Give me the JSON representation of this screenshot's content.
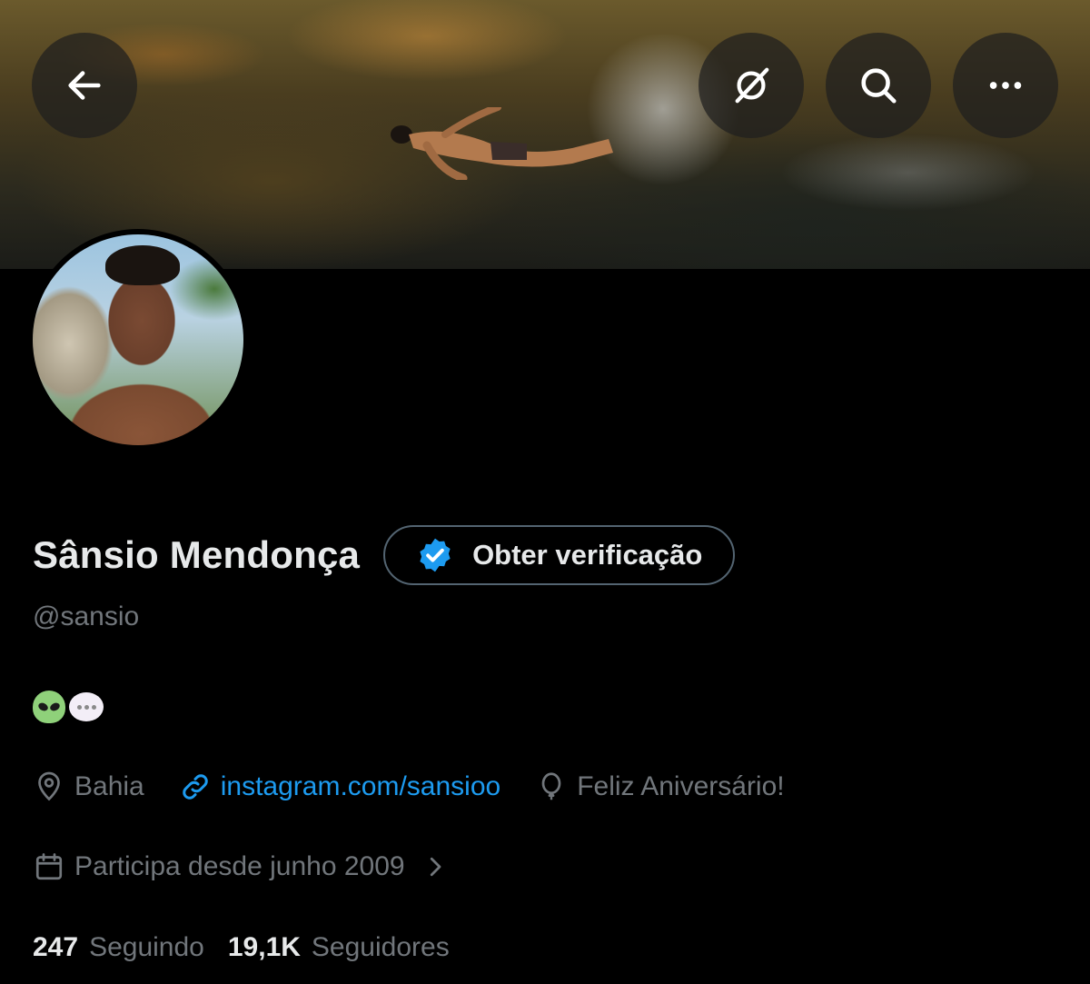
{
  "header": {
    "back_icon": "arrow-left-icon",
    "grok_icon": "grok-icon",
    "search_icon": "search-icon",
    "more_icon": "more-dots-icon"
  },
  "profile": {
    "name": "Sânsio Mendonça",
    "verify_button_label": "Obter verificação",
    "verify_icon": "verified-badge-icon",
    "handle": "@sansio",
    "bio_emojis": [
      "alien-emoji",
      "speech-bubble-emoji"
    ],
    "location": "Bahia",
    "website": "instagram.com/sansioo",
    "birthday": "Feliz Aniversário!",
    "joined": "Participa desde junho 2009",
    "following_count": "247",
    "following_label": "Seguindo",
    "followers_count": "19,1K",
    "followers_label": "Seguidores"
  },
  "colors": {
    "background": "#000000",
    "primary_text": "#e7e9ea",
    "secondary_text": "#71767b",
    "link": "#1d9bf0",
    "verify_badge": "#1d9bf0"
  }
}
